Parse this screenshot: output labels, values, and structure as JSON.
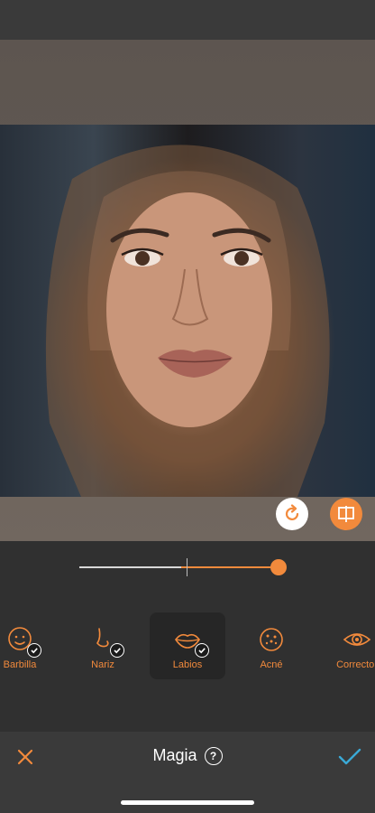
{
  "editor": {
    "title": "Magia",
    "help_symbol": "?",
    "close_icon": "close-icon",
    "apply_icon": "checkmark-icon"
  },
  "photo": {
    "description_icon": "portrait-photo"
  },
  "controls": {
    "reset_icon": "reset-icon",
    "compare_icon": "compare-icon"
  },
  "slider": {
    "value_fraction": 0.98,
    "center_fraction": 0.5,
    "accent": "#f28a3c"
  },
  "tools": [
    {
      "label": "Barbilla",
      "icon": "chin-icon",
      "applied": true,
      "selected": false
    },
    {
      "label": "Nariz",
      "icon": "nose-icon",
      "applied": true,
      "selected": false
    },
    {
      "label": "Labios",
      "icon": "lips-icon",
      "applied": true,
      "selected": true
    },
    {
      "label": "Acné",
      "icon": "acne-icon",
      "applied": false,
      "selected": false
    },
    {
      "label": "Corrector",
      "icon": "eye-icon",
      "applied": false,
      "selected": false
    }
  ],
  "colors": {
    "accent": "#f28a3c",
    "confirm": "#3aa9d6",
    "background": "#303030"
  }
}
